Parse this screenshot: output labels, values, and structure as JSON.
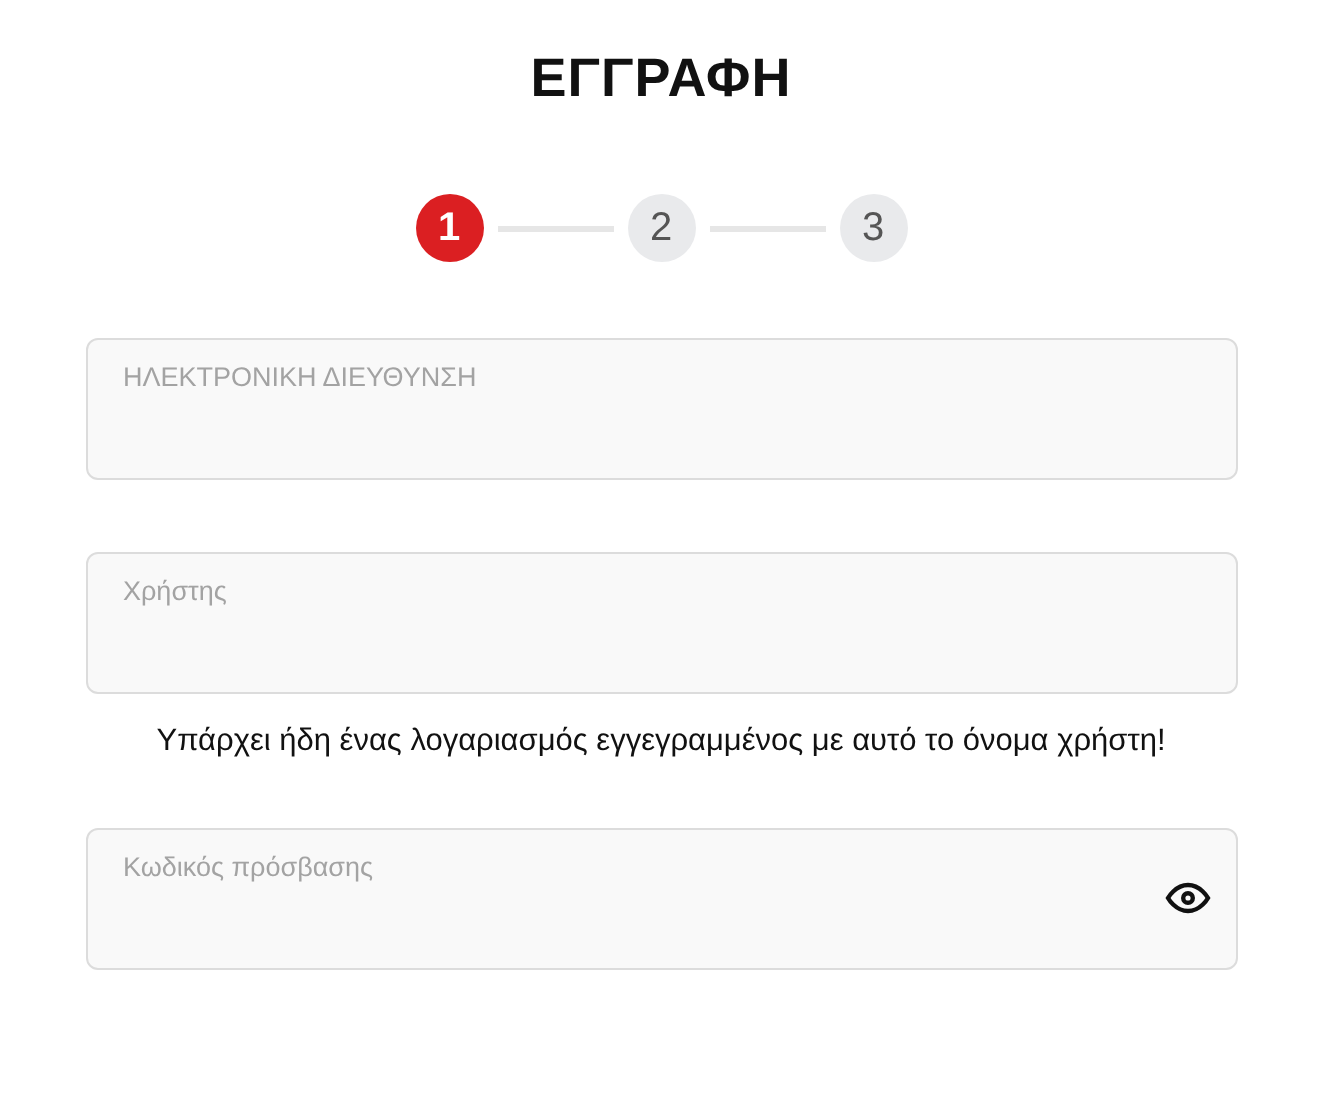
{
  "title": "ΕΓΓΡΑΦΗ",
  "steps": [
    {
      "label": "1",
      "selected": true
    },
    {
      "label": "2",
      "selected": false
    },
    {
      "label": "3",
      "selected": false
    }
  ],
  "fields": [
    {
      "kind": "text",
      "placeholder": "ΗΛΕΚΤΡΟΝΙΚΗ ΔΙΕΥΘΥΝΣΗ"
    },
    {
      "kind": "text",
      "placeholder": "Χρήστης",
      "error": "Υπάρχει ήδη ένας λογαριασμός εγγεγραμμένος με αυτό το όνομα χρήστη!"
    },
    {
      "kind": "password",
      "placeholder": "Κωδικός πρόσβασης"
    }
  ]
}
